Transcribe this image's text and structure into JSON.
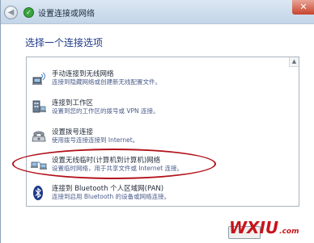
{
  "window": {
    "title": "设置连接或网络",
    "close_glyph": "✕",
    "back_glyph": "◀"
  },
  "heading": "选择一个连接选项",
  "options": [
    {
      "name": "手动连接到无线网络",
      "description": "连接到隐藏网络或创建新无线配置文件。",
      "icon": "wireless-network-icon"
    },
    {
      "name": "连接到工作区",
      "description": "设置到您的工作区的拨号或 VPN 连接。",
      "icon": "workplace-network-icon"
    },
    {
      "name": "设置拨号连接",
      "description": "使用拨号连接连接到 Internet。",
      "icon": "dialup-telephone-icon"
    },
    {
      "name": "设置无线临时(计算机到计算机)网络",
      "description": "设置临时网络，用于共享文件或 Internet 连接。",
      "icon": "adhoc-network-icon"
    },
    {
      "name": "连接到 Bluetooth 个人区域网(PAN)",
      "description": "连接到启用 Bluetooth 的设备或网络连接。",
      "icon": "bluetooth-icon"
    }
  ],
  "watermark": {
    "brand": "WXIU",
    "suffix": ".com"
  },
  "colors": {
    "heading": "#1e3a8a",
    "highlight": "#b3121b",
    "watermark": "#c7151b"
  }
}
